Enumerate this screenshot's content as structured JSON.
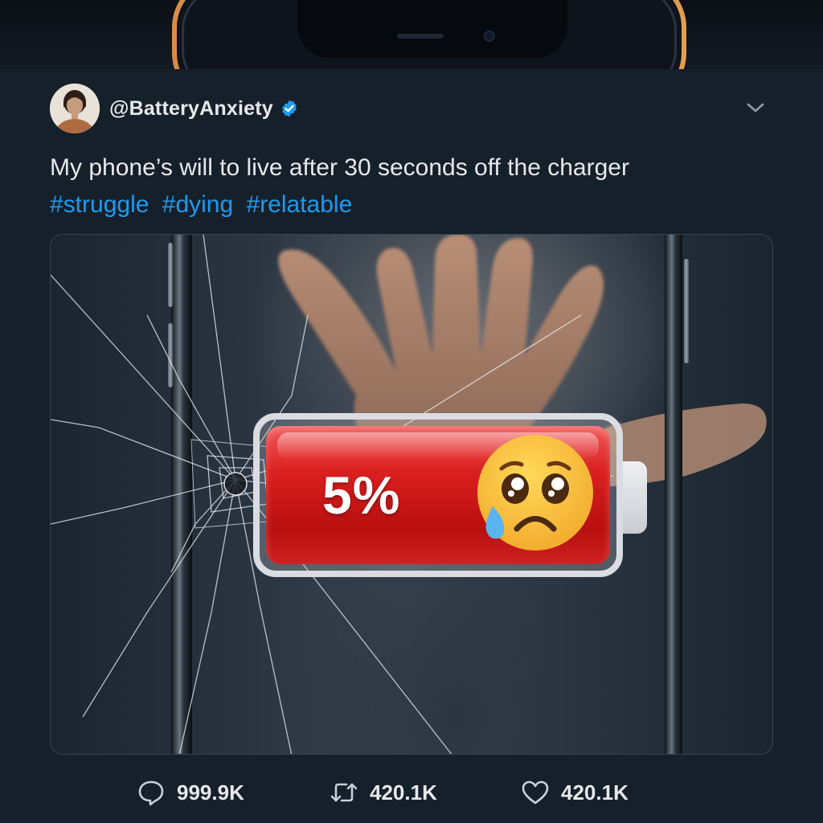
{
  "tweet": {
    "handle": "@BatteryAnxiety",
    "verified": true,
    "text": "My phone’s will to live after 30 seconds off the charger",
    "hashtags": [
      "#struggle",
      "#dying",
      "#relatable"
    ]
  },
  "media": {
    "battery_percent_label": "5%",
    "battery_level": 0.05,
    "battery_color": "#d91e1e"
  },
  "actions": {
    "replies": "999.9K",
    "retweets": "420.1K",
    "likes": "420.1K"
  },
  "colors": {
    "background": "#15202b",
    "link": "#1d9bf0",
    "verified": "#1d9bf0",
    "text": "#e7e9ea"
  },
  "icons": {
    "verified": "verified-badge-icon",
    "menu": "chevron-down-icon",
    "reply": "reply-icon",
    "retweet": "retweet-icon",
    "like": "heart-icon",
    "emoji": "sad-face-icon"
  }
}
